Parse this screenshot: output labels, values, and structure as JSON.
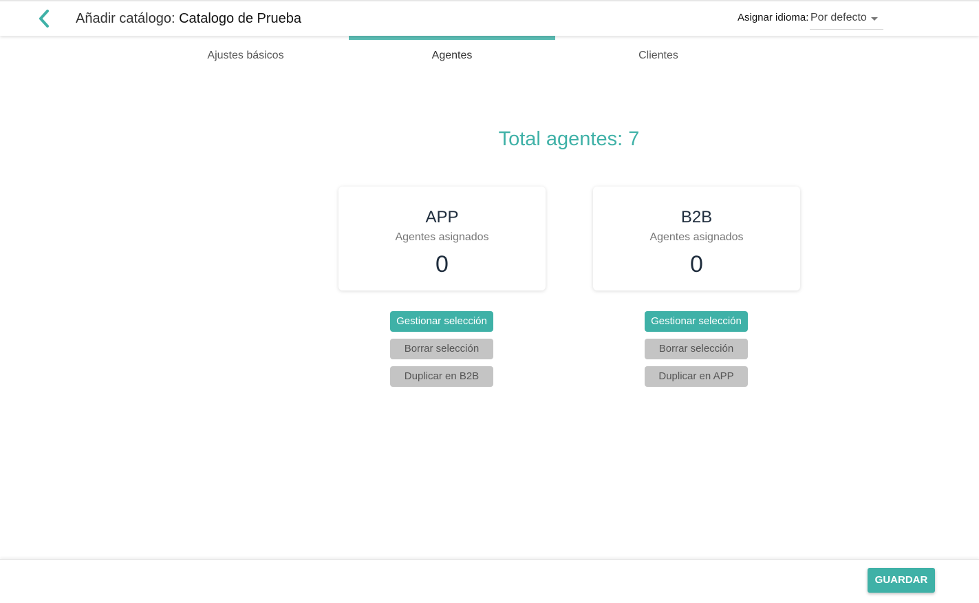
{
  "header": {
    "back_icon": "chevron-left-icon",
    "title_prefix": "Añadir catálogo: ",
    "title_name": "Catalogo de Prueba",
    "language_label": "Asignar idioma:",
    "language_value": "Por defecto",
    "language_caret_icon": "caret-down-icon"
  },
  "tabs": [
    {
      "label": "Ajustes básicos",
      "active": false
    },
    {
      "label": "Agentes",
      "active": true
    },
    {
      "label": "Clientes",
      "active": false
    }
  ],
  "main": {
    "total_label": "Total agentes: 7",
    "panels": [
      {
        "title": "APP",
        "subtitle": "Agentes asignados",
        "count": "0",
        "manage_label": "Gestionar selección",
        "clear_label": "Borrar selección",
        "duplicate_label": "Duplicar en B2B"
      },
      {
        "title": "B2B",
        "subtitle": "Agentes asignados",
        "count": "0",
        "manage_label": "Gestionar selección",
        "clear_label": "Borrar selección",
        "duplicate_label": "Duplicar en APP"
      }
    ]
  },
  "footer": {
    "save_label": "GUARDAR"
  },
  "colors": {
    "accent": "#3fb1a7",
    "tab_indicator": "#5bbdb4",
    "secondary_button": "#c4c4c4",
    "heading_dark": "#1f2d3d"
  }
}
